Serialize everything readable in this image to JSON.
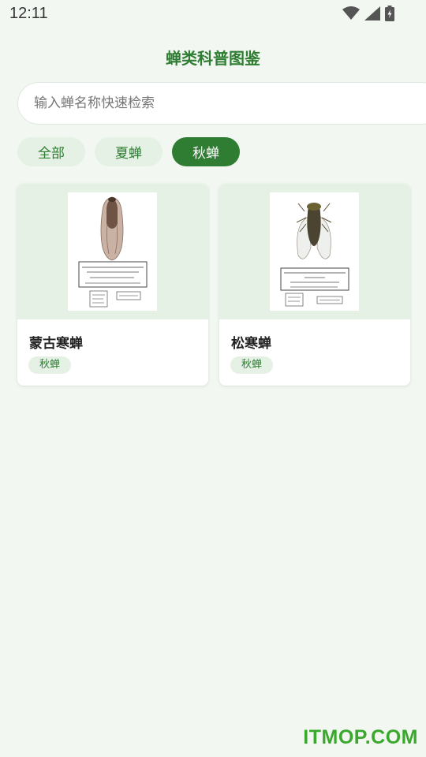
{
  "status_bar": {
    "time": "12:11",
    "icons": [
      "wifi-icon",
      "signal-icon",
      "battery-icon"
    ]
  },
  "header": {
    "title": "蝉类科普图鉴"
  },
  "search": {
    "placeholder": "输入蝉名称快速检索",
    "value": ""
  },
  "filters": [
    {
      "label": "全部",
      "selected": false
    },
    {
      "label": "夏蝉",
      "selected": false
    },
    {
      "label": "秋蝉",
      "selected": true
    }
  ],
  "cards": [
    {
      "name": "蒙古寒蝉",
      "tag": "秋蝉"
    },
    {
      "name": "松寒蝉",
      "tag": "秋蝉"
    }
  ],
  "watermark": "ITMOP.COM",
  "colors": {
    "accent": "#2e7d32",
    "chip_bg": "#e4f1e4",
    "page_bg": "#f2f7f2"
  }
}
